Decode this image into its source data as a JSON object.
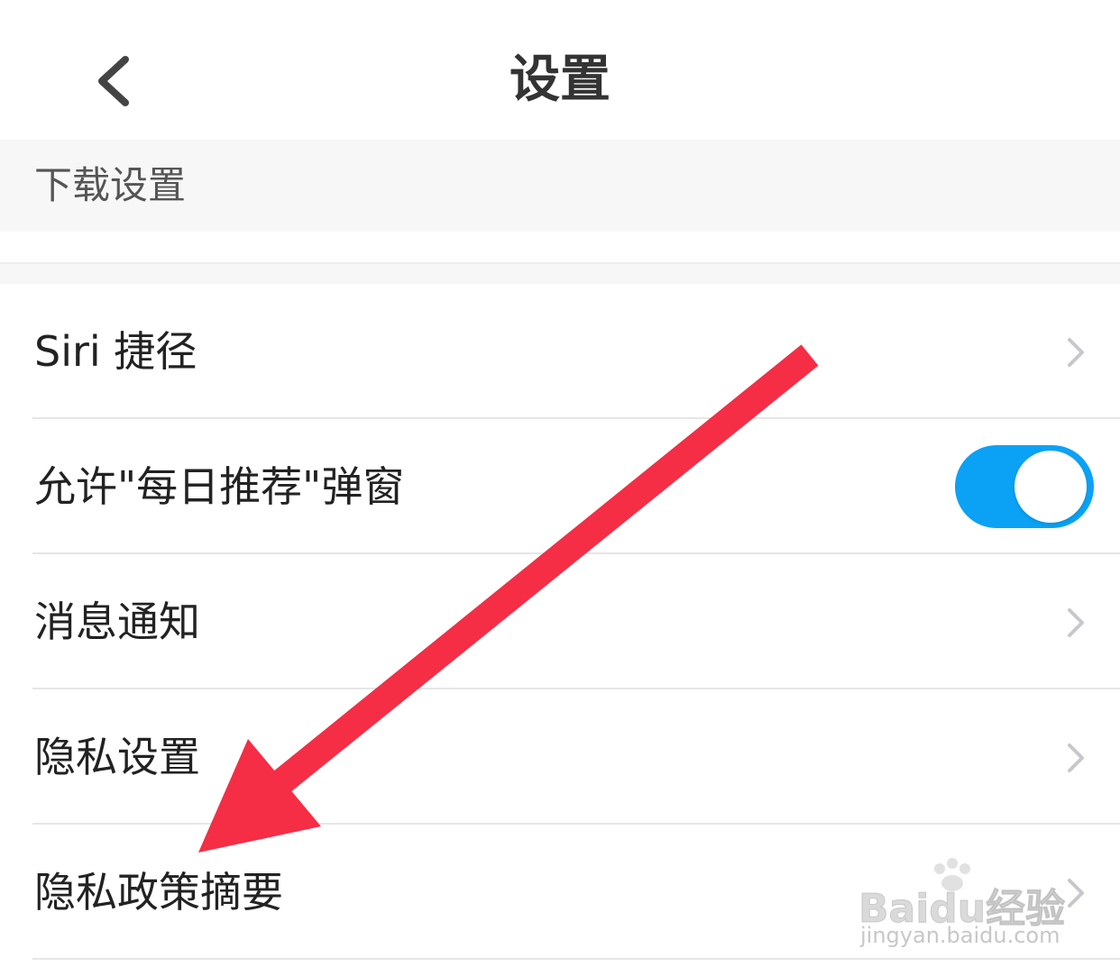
{
  "header": {
    "title": "设置",
    "back_icon": "chevron-left-icon"
  },
  "section": {
    "download_settings_label": "下载设置"
  },
  "settings": {
    "siri_shortcuts": {
      "label": "Siri 捷径",
      "accessory": "chevron-right-icon"
    },
    "daily_recommend_popup": {
      "label": "允许\"每日推荐\"弹窗",
      "toggle_on": true
    },
    "notifications": {
      "label": "消息通知",
      "accessory": "chevron-right-icon"
    },
    "privacy_settings": {
      "label": "隐私设置",
      "accessory": "chevron-right-icon"
    },
    "privacy_policy_summary": {
      "label": "隐私政策摘要",
      "accessory": "chevron-right-icon"
    }
  },
  "annotation": {
    "arrow_color": "#f52d45",
    "arrow_icon": "arrow-down-left-icon"
  },
  "watermark": {
    "brand": "Baidu经验",
    "domain": "jingyan.baidu.com"
  },
  "colors": {
    "toggle_on": "#0ba2f5",
    "section_background": "#f7f7f7",
    "chevron": "#c7c7cc"
  }
}
